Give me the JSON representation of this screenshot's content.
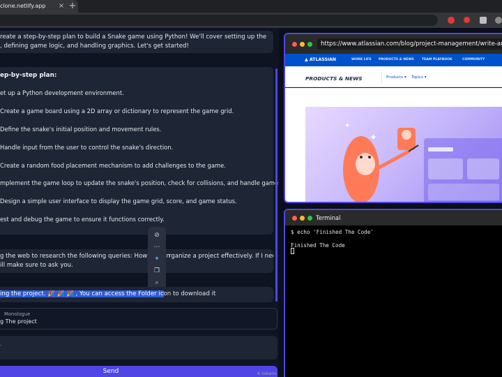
{
  "browser_chrome": {
    "tab_title": "clone.netlify.app",
    "tab_close": "×",
    "new_tab": "+",
    "colors": {
      "ext1": "#e53935",
      "ext2": "#e53935",
      "ext3": "#bdbdbd",
      "ext4": "#8a8a8a"
    }
  },
  "chat": {
    "intro_line1": "reate a step-by-step plan to build a Snake game using Python! We'll cover setting up the",
    "intro_line2": ", defining game logic, and handling graphics. Let's get started!",
    "plan_title": "ep-by-step plan:",
    "steps": [
      "et up a Python development environment.",
      "Create a game board using a 2D array or dictionary to represent the game grid.",
      "Define the snake's initial position and movement rules.",
      "Handle input from the user to control the snake's direction.",
      "Create a random food placement mechanism to add challenges to the game.",
      "mplement the game loop to update the snake's position, check for collisions, and handle game events.",
      "Design a simple user interface to display the game grid, score, and game status.",
      "est and debug the game to ensure it functions correctly."
    ],
    "research_line1": "g the web to research the following queries: How to plan",
    "research_line1_end": "rganize a project effectively. If I need",
    "research_line2": "ill make sure to ask you.",
    "done_selected": "ing the project. 🎉 🎉 🎉 , You can access the Folder ic",
    "done_rest": "on to download it",
    "monologue_label": "Monologue",
    "monologue_value": "g The project",
    "input_value": ".",
    "send_label": "Send",
    "tokens": "6 tokens",
    "float_icons": [
      "eye-off-icon",
      "more-icon",
      "thumbs-icon",
      "copy-icon",
      "search-icon"
    ]
  },
  "browser_panel": {
    "url": "https://www.atlassian.com/blog/project-management/write-an-effect",
    "nav_logo": "▲ ATLASSIAN",
    "nav_links": [
      "WORK LIFE",
      "PRODUCTS & NEWS",
      "TEAM PLAYBOOK",
      "COMMUNITY"
    ],
    "section_title": "PRODUCTS & NEWS",
    "sub_links": [
      "Products ▾",
      "Topics ▾"
    ],
    "colors": {
      "nav": "#0052cc",
      "accent": "#4f46e5"
    }
  },
  "terminal": {
    "title": "Terminal",
    "lines": [
      "$ echo 'Finished The Code'",
      "",
      "Finished The Code"
    ]
  }
}
